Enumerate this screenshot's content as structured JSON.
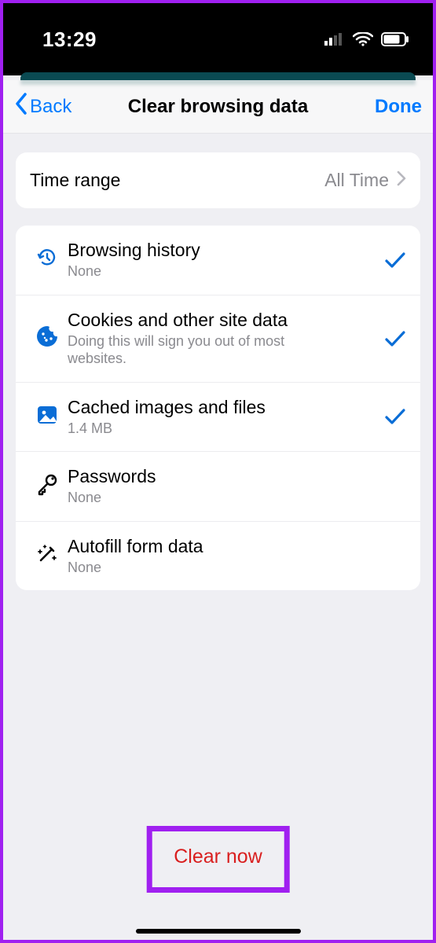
{
  "statusbar": {
    "time": "13:29"
  },
  "nav": {
    "back": "Back",
    "title": "Clear browsing data",
    "done": "Done"
  },
  "time_range": {
    "label": "Time range",
    "value": "All Time"
  },
  "items": [
    {
      "icon": "history-icon",
      "label": "Browsing history",
      "sub": "None",
      "checked": true
    },
    {
      "icon": "cookie-icon",
      "label": "Cookies and other site data",
      "sub": "Doing this will sign you out of most websites.",
      "checked": true
    },
    {
      "icon": "image-icon",
      "label": "Cached images and files",
      "sub": "1.4 MB",
      "checked": true
    },
    {
      "icon": "key-icon",
      "label": "Passwords",
      "sub": "None",
      "checked": false
    },
    {
      "icon": "wand-icon",
      "label": "Autofill form data",
      "sub": "None",
      "checked": false
    }
  ],
  "clear": {
    "label": "Clear now"
  },
  "colors": {
    "accent": "#0a6dd6",
    "link": "#007aff",
    "danger": "#d91f1f"
  }
}
